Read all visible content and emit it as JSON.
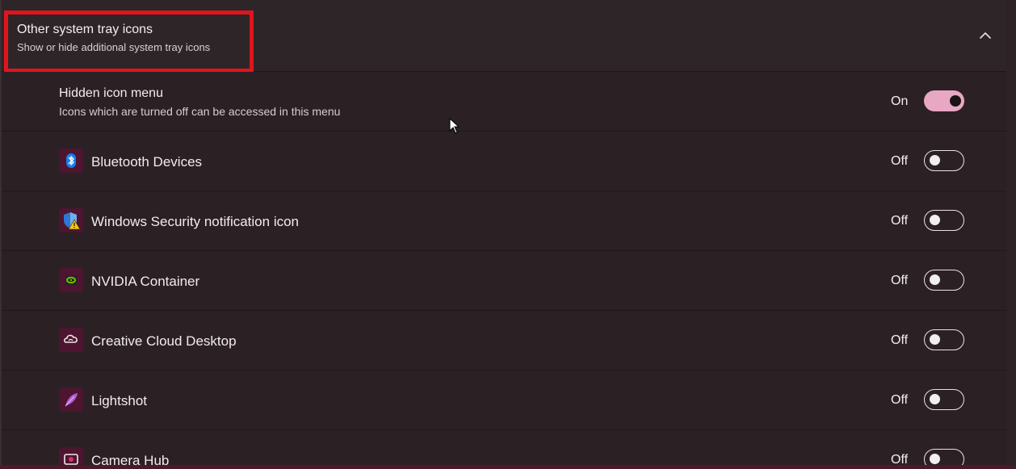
{
  "section": {
    "title": "Other system tray icons",
    "subtitle": "Show or hide additional system tray icons",
    "expanded": true,
    "highlight_color": "#e0151c"
  },
  "hidden_menu": {
    "title": "Hidden icon menu",
    "subtitle": "Icons which are turned off can be accessed in this menu",
    "state_label": "On",
    "on": true,
    "accent_color": "#e8a7c2"
  },
  "tray_items": [
    {
      "label": "Bluetooth Devices",
      "icon": "bluetooth-icon",
      "state_label": "Off",
      "on": false
    },
    {
      "label": "Windows Security notification icon",
      "icon": "windows-security-icon",
      "state_label": "Off",
      "on": false
    },
    {
      "label": "NVIDIA Container",
      "icon": "nvidia-icon",
      "state_label": "Off",
      "on": false
    },
    {
      "label": "Creative Cloud Desktop",
      "icon": "creative-cloud-icon",
      "state_label": "Off",
      "on": false
    },
    {
      "label": "Lightshot",
      "icon": "lightshot-icon",
      "state_label": "Off",
      "on": false
    },
    {
      "label": "Camera Hub",
      "icon": "camera-hub-icon",
      "state_label": "Off",
      "on": false
    }
  ]
}
